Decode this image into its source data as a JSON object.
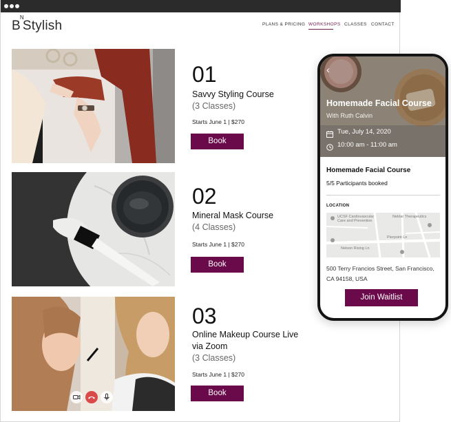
{
  "site": {
    "logo_main": "Stylish",
    "logo_prefix": "B",
    "logo_sup": "N"
  },
  "nav": {
    "items": [
      "PLANS & PRICING",
      "WORKSHOPS",
      "CLASSES",
      "CONTACT"
    ],
    "active": "WORKSHOPS"
  },
  "courses": [
    {
      "number": "01",
      "title": "Savvy Styling Course",
      "classes": "(3 Classes)",
      "meta": "Starts June 1 |  $270",
      "button": "Book"
    },
    {
      "number": "02",
      "title": "Mineral Mask Course",
      "classes": "(4 Classes)",
      "meta": "Starts June 1 |  $270",
      "button": "Book"
    },
    {
      "number": "03",
      "title": "Online Makeup Course Live via Zoom",
      "classes": "(3 Classes)",
      "meta": "Starts June 1 |  $270",
      "button": "Book"
    }
  ],
  "phone": {
    "hero_title": "Homemade Facial Course",
    "hero_subtitle": "With Ruth Calvin",
    "date": "Tue, July 14, 2020",
    "time": "10:00 am - 11:00 am",
    "title": "Homemade Facial Course",
    "booked": "5/5 Participants booked",
    "location_label": "LOCATION",
    "map_labels": [
      "UCSF Cardiovascular Care and Prevention",
      "Nektar Therapeutics",
      "Nelson Rising Ln",
      "Pierpoint Ln"
    ],
    "address_line1": "500 Terry Francios Street, San Francisco,",
    "address_line2": "CA 94158, USA",
    "waitlist_button": "Join Waitlist"
  },
  "colors": {
    "accent": "#6b0a4a",
    "browser_bar": "#2b2b2b",
    "phone_frame": "#141414"
  }
}
